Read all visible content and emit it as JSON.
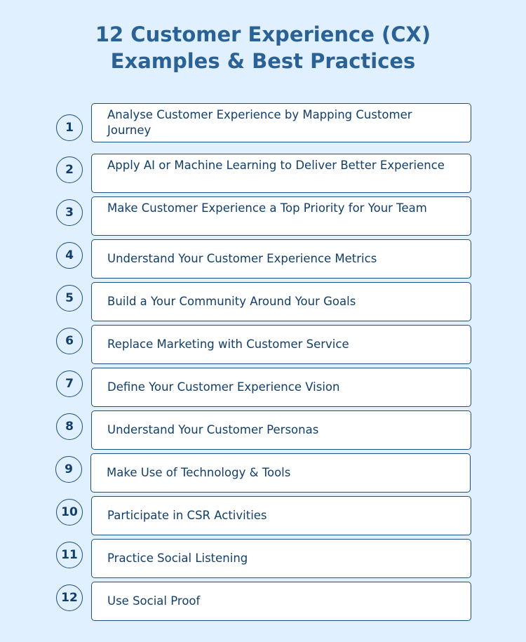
{
  "title": {
    "line1": "12 Customer Experience (CX)",
    "line2": "Examples & Best Practices"
  },
  "items": [
    {
      "number": "1",
      "text": "Analyse Customer Experience by Mapping Customer Journey"
    },
    {
      "number": "2",
      "text": "Apply AI or Machine Learning to Deliver Better Experience"
    },
    {
      "number": "3",
      "text": "Make Customer Experience a Top Priority for Your Team"
    },
    {
      "number": "4",
      "text": "Understand Your Customer Experience Metrics"
    },
    {
      "number": "5",
      "text": "Build a Your Community Around Your Goals"
    },
    {
      "number": "6",
      "text": "Replace Marketing with Customer Service"
    },
    {
      "number": "7",
      "text": "Define Your Customer Experience Vision"
    },
    {
      "number": "8",
      "text": "Understand Your Customer Personas"
    },
    {
      "number": "9",
      "text": "Make Use of Technology & Tools"
    },
    {
      "number": "10",
      "text": "Participate in CSR Activities"
    },
    {
      "number": "11",
      "text": "Practice Social Listening"
    },
    {
      "number": "12",
      "text": "Use Social Proof"
    }
  ]
}
